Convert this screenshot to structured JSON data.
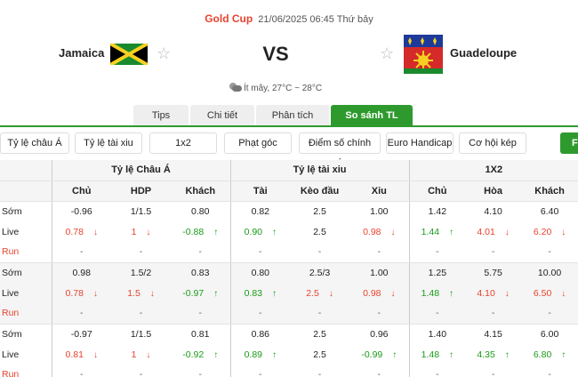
{
  "match": {
    "league": "Gold Cup",
    "datetime": "21/06/2025 06:45 Thứ bảy",
    "home": "Jamaica",
    "away": "Guadeloupe",
    "vs": "VS",
    "weather": "Ít mây, 27°C ~ 28°C"
  },
  "tabs": [
    "Tips",
    "Chi tiết",
    "Phân tích",
    "So sánh TL"
  ],
  "active_tab": "So sánh TL",
  "filters": [
    "Tỷ lệ châu Á",
    "Tỷ lệ tài xiu",
    "1x2",
    "Phạt góc",
    "Điểm số chính xác",
    "Euro Handicap",
    "Cơ hội kép"
  ],
  "filter_edge_label": "F",
  "plus_label": "+",
  "table": {
    "groups": [
      "Tỷ lệ Châu Á",
      "Tỷ lệ tài xiu",
      "1X2"
    ],
    "subheaders": [
      "Chủ",
      "HDP",
      "Khách",
      "Tài",
      "Kèo đầu",
      "Xiu",
      "Chủ",
      "Hòa",
      "Khách"
    ],
    "rows": [
      {
        "label": "Sớm",
        "cells": [
          "-0.96",
          "1/1.5",
          "0.80",
          "0.82",
          "2.5",
          "1.00",
          "1.42",
          "4.10",
          "6.40"
        ],
        "dirs": [
          "",
          "",
          "",
          "",
          "",
          "",
          "",
          "",
          ""
        ]
      },
      {
        "label": "Live",
        "cells": [
          "0.78",
          "1",
          "-0.88",
          "0.90",
          "2.5",
          "0.98",
          "1.44",
          "4.01",
          "6.20"
        ],
        "dirs": [
          "down",
          "down",
          "up",
          "up",
          "",
          "down",
          "up",
          "down",
          "down"
        ]
      },
      {
        "label": "Run",
        "cells": [
          "-",
          "-",
          "-",
          "-",
          "-",
          "-",
          "-",
          "-",
          "-"
        ],
        "dirs": [
          "",
          "",
          "",
          "",
          "",
          "",
          "",
          "",
          ""
        ]
      },
      {
        "label": "Sớm",
        "cells": [
          "0.98",
          "1.5/2",
          "0.83",
          "0.80",
          "2.5/3",
          "1.00",
          "1.25",
          "5.75",
          "10.00"
        ],
        "dirs": [
          "",
          "",
          "",
          "",
          "",
          "",
          "",
          "",
          ""
        ]
      },
      {
        "label": "Live",
        "cells": [
          "0.78",
          "1.5",
          "-0.97",
          "0.83",
          "2.5",
          "0.98",
          "1.48",
          "4.10",
          "6.50"
        ],
        "dirs": [
          "down",
          "down",
          "up",
          "up",
          "down",
          "down",
          "up",
          "down",
          "down"
        ]
      },
      {
        "label": "Run",
        "cells": [
          "-",
          "-",
          "-",
          "-",
          "-",
          "-",
          "-",
          "-",
          "-"
        ],
        "dirs": [
          "",
          "",
          "",
          "",
          "",
          "",
          "",
          "",
          ""
        ]
      },
      {
        "label": "Sớm",
        "cells": [
          "-0.97",
          "1/1.5",
          "0.81",
          "0.86",
          "2.5",
          "0.96",
          "1.40",
          "4.15",
          "6.00"
        ],
        "dirs": [
          "",
          "",
          "",
          "",
          "",
          "",
          "",
          "",
          ""
        ]
      },
      {
        "label": "Live",
        "cells": [
          "0.81",
          "1",
          "-0.92",
          "0.89",
          "2.5",
          "-0.99",
          "1.48",
          "4.35",
          "6.80"
        ],
        "dirs": [
          "down",
          "down",
          "up",
          "up",
          "",
          "up",
          "up",
          "up",
          "up"
        ]
      },
      {
        "label": "Run",
        "cells": [
          "-",
          "-",
          "-",
          "-",
          "-",
          "-",
          "-",
          "-",
          "-"
        ],
        "dirs": [
          "",
          "",
          "",
          "",
          "",
          "",
          "",
          "",
          ""
        ]
      }
    ]
  },
  "icons": {
    "favorite": "star-outline-icon",
    "weather": "cloud-sun-icon",
    "up": "arrow-up-icon",
    "down": "arrow-down-icon"
  },
  "colors": {
    "accent_green": "#2e9a2e",
    "down_red": "#e8432f",
    "up_green": "#1a9a1a",
    "league_red": "#e8432f"
  }
}
